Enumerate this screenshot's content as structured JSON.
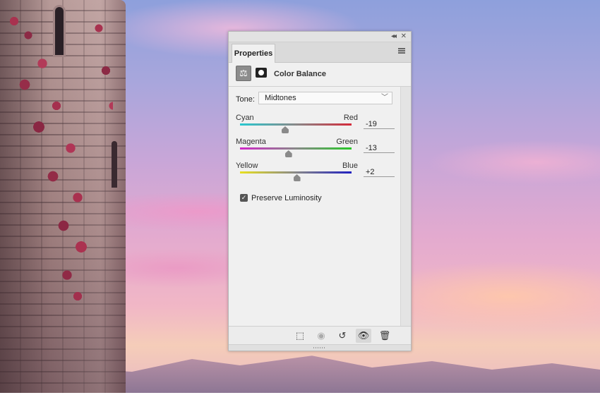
{
  "panel": {
    "tab_label": "Properties",
    "adjustment_title": "Color Balance",
    "tone": {
      "label": "Tone:",
      "value": "Midtones"
    },
    "sliders": [
      {
        "left": "Cyan",
        "right": "Red",
        "value": "-19",
        "numeric": -19,
        "gradient": [
          "#28c8d0",
          "#d42a3a"
        ]
      },
      {
        "left": "Magenta",
        "right": "Green",
        "value": "-13",
        "numeric": -13,
        "gradient": [
          "#d028c8",
          "#28c828"
        ]
      },
      {
        "left": "Yellow",
        "right": "Blue",
        "value": "+2",
        "numeric": 2,
        "gradient": [
          "#e8e020",
          "#2020c0"
        ]
      }
    ],
    "slider_range": [
      -100,
      100
    ],
    "preserve_luminosity": {
      "label": "Preserve Luminosity",
      "checked": true
    },
    "icons": {
      "titlebar": [
        "collapse-icon",
        "close-icon"
      ],
      "header": [
        "balance-scale-icon",
        "layer-mask-icon"
      ],
      "footer": [
        "clip-to-layer-icon",
        "view-previous-state-icon",
        "reset-icon",
        "visibility-eye-icon",
        "trash-icon"
      ]
    }
  }
}
